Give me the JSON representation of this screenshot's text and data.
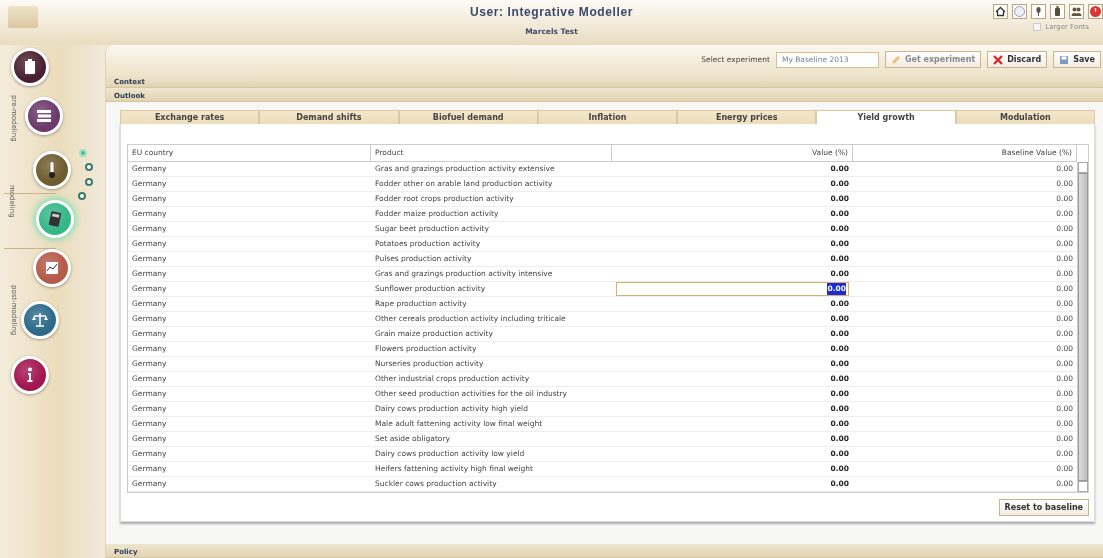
{
  "header": {
    "title": "User: Integrative Modeller",
    "subtitle": "Marcels Test",
    "larger_fonts": {
      "label": "Larger Fonts",
      "checked": false
    }
  },
  "sidebar": {
    "phases": [
      {
        "label": "pre-modeling"
      },
      {
        "label": "modeling"
      },
      {
        "label": "post-modeling"
      }
    ],
    "items": [
      {
        "kind": "clipboard",
        "selected": false
      },
      {
        "kind": "books",
        "selected": false
      },
      {
        "kind": "thermometer",
        "selected": false
      },
      {
        "kind": "calculator",
        "selected": true
      },
      {
        "kind": "chart",
        "selected": false
      },
      {
        "kind": "scales",
        "selected": false
      },
      {
        "kind": "info",
        "selected": false
      }
    ],
    "steps": [
      {
        "selected": true
      },
      {
        "selected": false
      },
      {
        "selected": false
      },
      {
        "selected": false
      }
    ]
  },
  "experiment": {
    "label": "Select experiment",
    "value": "My Baseline 2013",
    "disabled": true,
    "get_button": {
      "label": "Get experiment",
      "disabled": true
    },
    "discard_button": {
      "label": "Discard"
    },
    "save_button": {
      "label": "Save"
    }
  },
  "sections": [
    {
      "label": "Context"
    },
    {
      "label": "Outlook"
    }
  ],
  "tabs": [
    {
      "label": "Exchange rates",
      "selected": false
    },
    {
      "label": "Demand shifts",
      "selected": false
    },
    {
      "label": "Biofuel demand",
      "selected": false
    },
    {
      "label": "Inflation",
      "selected": false
    },
    {
      "label": "Energy prices",
      "selected": false
    },
    {
      "label": "Yield growth",
      "selected": true
    },
    {
      "label": "Modulation",
      "selected": false
    }
  ],
  "table": {
    "columns": [
      "EU country",
      "Product",
      "Value (%)",
      "Baseline Value (%)"
    ],
    "rows": [
      {
        "country": "Germany",
        "product": "Gras and grazings production activity extensive",
        "value": "0.00",
        "baseline": "0.00",
        "editing": false
      },
      {
        "country": "Germany",
        "product": "Fodder other on arable land production activity",
        "value": "0.00",
        "baseline": "0.00",
        "editing": false
      },
      {
        "country": "Germany",
        "product": "Fodder root crops production activity",
        "value": "0.00",
        "baseline": "0.00",
        "editing": false
      },
      {
        "country": "Germany",
        "product": "Fodder maize production activity",
        "value": "0.00",
        "baseline": "0.00",
        "editing": false
      },
      {
        "country": "Germany",
        "product": "Sugar beet production activity",
        "value": "0.00",
        "baseline": "0.00",
        "editing": false
      },
      {
        "country": "Germany",
        "product": "Potatoes production activity",
        "value": "0.00",
        "baseline": "0.00",
        "editing": false
      },
      {
        "country": "Germany",
        "product": "Pulses production activity",
        "value": "0.00",
        "baseline": "0.00",
        "editing": false
      },
      {
        "country": "Germany",
        "product": "Gras and grazings production activity intensive",
        "value": "0.00",
        "baseline": "0.00",
        "editing": false
      },
      {
        "country": "Germany",
        "product": "Sunflower production activity",
        "value": "0.00",
        "baseline": "0.00",
        "editing": true
      },
      {
        "country": "Germany",
        "product": "Rape production activity",
        "value": "0.00",
        "baseline": "0.00",
        "editing": false
      },
      {
        "country": "Germany",
        "product": "Other cereals production activity including triticale",
        "value": "0.00",
        "baseline": "0.00",
        "editing": false
      },
      {
        "country": "Germany",
        "product": "Grain maize production activity",
        "value": "0.00",
        "baseline": "0.00",
        "editing": false
      },
      {
        "country": "Germany",
        "product": "Flowers production activity",
        "value": "0.00",
        "baseline": "0.00",
        "editing": false
      },
      {
        "country": "Germany",
        "product": "Nurseries production activity",
        "value": "0.00",
        "baseline": "0.00",
        "editing": false
      },
      {
        "country": "Germany",
        "product": "Other industrial crops production activity",
        "value": "0.00",
        "baseline": "0.00",
        "editing": false
      },
      {
        "country": "Germany",
        "product": "Other seed production activities for the oil industry",
        "value": "0.00",
        "baseline": "0.00",
        "editing": false
      },
      {
        "country": "Germany",
        "product": "Dairy cows  production activity high yield",
        "value": "0.00",
        "baseline": "0.00",
        "editing": false
      },
      {
        "country": "Germany",
        "product": "Male adult fattening activity low final weight",
        "value": "0.00",
        "baseline": "0.00",
        "editing": false
      },
      {
        "country": "Germany",
        "product": "Set aside obligatory",
        "value": "0.00",
        "baseline": "0.00",
        "editing": false
      },
      {
        "country": "Germany",
        "product": "Dairy cows production activity low yield",
        "value": "0.00",
        "baseline": "0.00",
        "editing": false
      },
      {
        "country": "Germany",
        "product": "Heifers fattening activity high final weight",
        "value": "0.00",
        "baseline": "0.00",
        "editing": false
      },
      {
        "country": "Germany",
        "product": "Suckler cows production activity",
        "value": "0.00",
        "baseline": "0.00",
        "editing": false
      }
    ],
    "reset_button": {
      "label": "Reset to baseline"
    }
  },
  "footer_section": {
    "label": "Policy"
  }
}
